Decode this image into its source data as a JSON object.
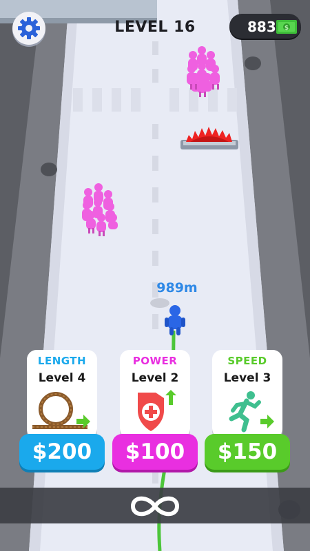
{
  "hud": {
    "level_label": "LEVEL 16",
    "cash": "883",
    "settings_icon": "gear-icon",
    "cash_icon": "money-bill-icon"
  },
  "player": {
    "distance": "989m"
  },
  "upgrades": [
    {
      "title": "LENGTH",
      "level": "Level 4",
      "price": "$200",
      "icon": "rope-coil-icon",
      "color": "#1aa9ec"
    },
    {
      "title": "POWER",
      "level": "Level 2",
      "price": "$100",
      "icon": "shield-cross-icon",
      "color": "#e92fe0"
    },
    {
      "title": "SPEED",
      "level": "Level 3",
      "price": "$150",
      "icon": "running-man-icon",
      "color": "#59cb2b"
    }
  ],
  "controls": {
    "hold_hint_icon": "infinity-icon"
  },
  "colors": {
    "road": "#e9ecf6",
    "crowd": "#ef60e0",
    "saw": "#ee2222",
    "player": "#2a66e6",
    "rope": "#4cc53a"
  }
}
